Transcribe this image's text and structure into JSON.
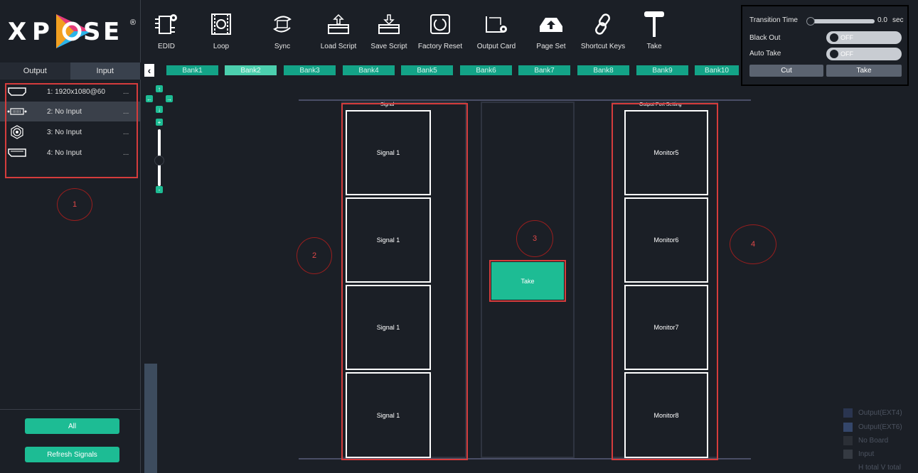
{
  "app": {
    "brand": "XPOSE",
    "reg": "®"
  },
  "left_tabs": [
    {
      "label": "Output"
    },
    {
      "label": "Input"
    }
  ],
  "inputs": [
    {
      "label": "1: 1920x1080@60",
      "more": "...",
      "icon": "hdmi-icon"
    },
    {
      "label": "2: No Input",
      "more": "...",
      "icon": "dvi-icon"
    },
    {
      "label": "3: No Input",
      "more": "...",
      "icon": "sdi-icon"
    },
    {
      "label": "4: No Input",
      "more": "...",
      "icon": "displayport-icon"
    }
  ],
  "left_buttons": {
    "all": "All",
    "refresh": "Refresh Signals"
  },
  "toolbar": [
    {
      "label": "EDID",
      "icon": "edid-chip-icon"
    },
    {
      "label": "Loop",
      "icon": "loop-icon"
    },
    {
      "label": "Sync",
      "icon": "sync-icon"
    },
    {
      "label": "Load Script",
      "icon": "load-script-icon"
    },
    {
      "label": "Save Script",
      "icon": "save-script-icon"
    },
    {
      "label": "Factory Reset",
      "icon": "factory-reset-icon"
    },
    {
      "label": "Output Card",
      "icon": "output-card-icon"
    },
    {
      "label": "Page Set",
      "icon": "page-set-icon"
    },
    {
      "label": "Shortcut Keys",
      "icon": "link-icon"
    },
    {
      "label": "Take",
      "icon": "take-icon"
    }
  ],
  "banks": [
    "Bank1",
    "Bank2",
    "Bank3",
    "Bank4",
    "Bank5",
    "Bank6",
    "Bank7",
    "Bank8",
    "Bank9",
    "Bank10"
  ],
  "selected_bank": "Bank2",
  "transition": {
    "time_label": "Transition Time",
    "time_value": "0.0",
    "time_unit": "sec",
    "black_out_label": "Black Out",
    "black_out_state": "OFF",
    "auto_take_label": "Auto Take",
    "auto_take_state": "OFF",
    "cut_label": "Cut",
    "take_label": "Take"
  },
  "zoom": {
    "up": "↑",
    "left": "←",
    "right": "→",
    "down": "↓",
    "plus": "+",
    "minus": "-"
  },
  "signal_column": {
    "title": "Signal",
    "tiles": [
      "Signal 1",
      "Signal 1",
      "Signal 1",
      "Signal 1"
    ]
  },
  "output_column": {
    "title": "Output Port  Setting",
    "tiles": [
      "Monitor5",
      "Monitor6",
      "Monitor7",
      "Monitor8"
    ]
  },
  "take_button": "Take",
  "annotations": [
    "1",
    "2",
    "3",
    "4"
  ],
  "legend": [
    {
      "label": "Output(EXT4)",
      "color": "#2a3550"
    },
    {
      "label": "Output(EXT6)",
      "color": "#34466a"
    },
    {
      "label": "No Board",
      "color": "#2b2f36"
    },
    {
      "label": "Input",
      "color": "#353a42"
    },
    {
      "label": "H total V total",
      "color": "#1b1f26"
    }
  ],
  "colors": {
    "accent": "#1dbc94",
    "bank": "#13a387",
    "bank_selected": "#4ccfae",
    "annotation": "#d53c3c"
  }
}
